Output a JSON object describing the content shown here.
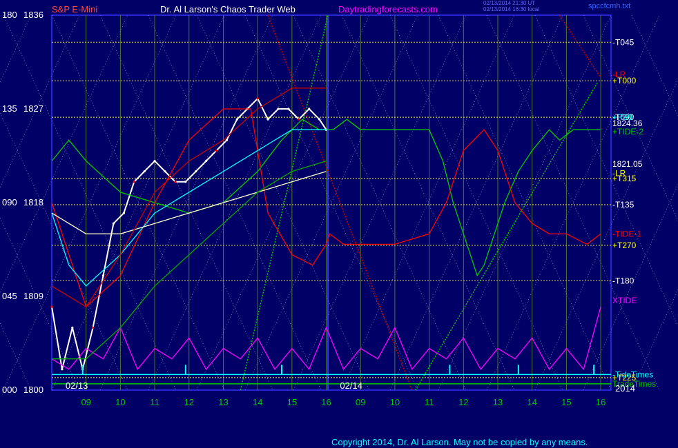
{
  "header": {
    "ticker": "S&P E-Mini",
    "title": "Dr. Al Larson's Chaos Trader Web",
    "website": "Daytradingforecasts.com",
    "timestamp1": "02/13/2014 21:30 UT",
    "timestamp2": "02/13/2014 16:30 local",
    "file": "spccfcmh.txt",
    "copyright": "Copyright 2014, Dr. Al Larson. May not be copied by any means."
  },
  "colors": {
    "background": "#000066",
    "plot_border": "#3333ff",
    "grid": "#4a7a2a",
    "yellow": "#ffff00",
    "red": "#ff0000",
    "green": "#00cc00",
    "cyan": "#00ffff",
    "magenta": "#ff00ff",
    "white": "#ffffff"
  },
  "chart_data": {
    "type": "line",
    "title": "S&P E-Mini",
    "y_ticks": [
      {
        "angle": "180",
        "price": "1836",
        "value": 1836
      },
      {
        "angle": "135",
        "price": "1827",
        "value": 1827
      },
      {
        "angle": "090",
        "price": "1818",
        "value": 1818
      },
      {
        "angle": "045",
        "price": "1809",
        "value": 1809
      },
      {
        "angle": "000",
        "price": "1800",
        "value": 1800
      }
    ],
    "ylim": [
      1800,
      1836
    ],
    "xlim": [
      8.0,
      24.3
    ],
    "date_labels": [
      {
        "label": "02/13",
        "x": 8.4
      },
      {
        "label": "02/14",
        "x": 16.4
      }
    ],
    "year_label": "2014",
    "x_ticks": [
      {
        "label": "09",
        "x": 9
      },
      {
        "label": "10",
        "x": 10
      },
      {
        "label": "11",
        "x": 11
      },
      {
        "label": "12",
        "x": 12
      },
      {
        "label": "13",
        "x": 13
      },
      {
        "label": "14",
        "x": 14
      },
      {
        "label": "15",
        "x": 15
      },
      {
        "label": "16",
        "x": 16
      },
      {
        "label": "09",
        "x": 17
      },
      {
        "label": "10",
        "x": 18
      },
      {
        "label": "11",
        "x": 19
      },
      {
        "label": "12",
        "x": 20
      },
      {
        "label": "13",
        "x": 21
      },
      {
        "label": "14",
        "x": 22
      },
      {
        "label": "15",
        "x": 23
      },
      {
        "label": "16",
        "x": 24
      }
    ],
    "day_divider_x": 16.05,
    "horizontal_levels": [
      {
        "label": "-T045",
        "value": 1833.4,
        "color": "#ffffff"
      },
      {
        "label": "+T000",
        "value": 1829.7,
        "color": "#ffff00"
      },
      {
        "label": "-T090",
        "value": 1826.2,
        "color": "#ffffff"
      },
      {
        "label": "+T315",
        "value": 1820.3,
        "color": "#ffff00"
      },
      {
        "label": "-T135",
        "value": 1817.8,
        "color": "#ffffff"
      },
      {
        "label": "+T270",
        "value": 1813.9,
        "color": "#ffff00"
      },
      {
        "label": "-T180",
        "value": 1810.5,
        "color": "#ffffff"
      },
      {
        "label": "+T225",
        "value": 1801.2,
        "color": "#ffff00"
      }
    ],
    "right_labels": [
      {
        "text": "-LR",
        "value": 1830.3,
        "color": "#ff0000"
      },
      {
        "text": "1824.36",
        "value": 1825.6,
        "color": "#ffffff"
      },
      {
        "text": "+R99",
        "value": 1826.2,
        "color": "#00ffff"
      },
      {
        "text": "+TIDE-2",
        "value": 1824.8,
        "color": "#00cc00"
      },
      {
        "text": "1821.05",
        "value": 1821.7,
        "color": "#ffffff"
      },
      {
        "text": "-LR",
        "value": 1820.8,
        "color": "#ffff00"
      },
      {
        "text": "-TIDE-1",
        "value": 1815.0,
        "color": "#ff0000"
      },
      {
        "text": "XTIDE",
        "value": 1808.6,
        "color": "#ff00ff"
      },
      {
        "text": "-TideTimes",
        "value": 1801.5,
        "color": "#00ffff"
      },
      {
        "text": "TradeTimes",
        "value": 1800.6,
        "color": "#00cc00"
      }
    ],
    "series": [
      {
        "name": "price",
        "color": "#ffffff",
        "x": [
          8.0,
          8.3,
          8.6,
          8.9,
          9.2,
          9.5,
          9.8,
          10.1,
          10.4,
          10.7,
          11.0,
          11.3,
          11.6,
          11.9,
          12.2,
          12.5,
          12.8,
          13.1,
          13.4,
          13.7,
          14.0,
          14.3,
          14.6,
          14.9,
          15.2,
          15.5,
          15.8,
          16.0
        ],
        "y": [
          1808,
          1802,
          1806,
          1802,
          1806,
          1811,
          1816,
          1817,
          1820,
          1821,
          1822,
          1821,
          1820,
          1820,
          1821,
          1822,
          1823,
          1824,
          1826,
          1827,
          1828,
          1826,
          1827,
          1827,
          1826,
          1827,
          1826,
          1825
        ]
      },
      {
        "name": "TIDE-2",
        "color": "#00cc00",
        "x": [
          8.0,
          8.5,
          9.0,
          10.0,
          11.0,
          12.0,
          13.0,
          14.0,
          14.7,
          15.3,
          15.8,
          16.2,
          16.6,
          17.0,
          18.0,
          19.0,
          19.4,
          19.7,
          20.0,
          20.4,
          20.6,
          20.8,
          21.2,
          21.6,
          22.0,
          22.5,
          22.8,
          23.2,
          23.6,
          24.0
        ],
        "y": [
          1822,
          1824,
          1822,
          1819,
          1818,
          1817,
          1818,
          1821,
          1824,
          1826,
          1825,
          1825,
          1826,
          1825,
          1825,
          1825,
          1822,
          1818,
          1815,
          1811,
          1812,
          1814,
          1818,
          1821,
          1823,
          1825,
          1824,
          1825,
          1825,
          1825
        ]
      },
      {
        "name": "TIDE-1",
        "color": "#ff0000",
        "x": [
          8.0,
          9.0,
          10.0,
          11.0,
          12.0,
          13.0,
          13.8,
          14.3,
          15.0,
          15.6,
          16.0,
          16.1,
          16.5,
          17.0,
          18.0,
          19.0,
          19.5,
          20.0,
          20.6,
          21.0,
          21.5,
          22.0,
          22.5,
          23.0,
          23.6,
          24.0
        ],
        "y": [
          1818,
          1808,
          1811,
          1818,
          1824,
          1827,
          1827,
          1817,
          1813,
          1812,
          1814,
          1815,
          1814,
          1814,
          1814,
          1815,
          1818,
          1823,
          1825,
          1823,
          1818,
          1816,
          1815,
          1815,
          1814,
          1815
        ]
      },
      {
        "name": "XTIDE",
        "color": "#ff00ff",
        "x": [
          8.0,
          8.5,
          9.0,
          9.5,
          10.0,
          10.5,
          11.0,
          11.5,
          12.0,
          12.5,
          13.0,
          13.5,
          14.0,
          14.5,
          15.0,
          15.5,
          16.0,
          16.5,
          17.0,
          17.5,
          18.0,
          18.5,
          19.0,
          19.5,
          20.0,
          20.5,
          21.0,
          21.5,
          22.0,
          22.5,
          23.0,
          23.5,
          24.0
        ],
        "y": [
          1803,
          1802,
          1804,
          1803,
          1806,
          1802,
          1804,
          1803,
          1805,
          1802,
          1804,
          1803,
          1805,
          1802,
          1804,
          1802,
          1806,
          1802,
          1804,
          1803,
          1806,
          1802,
          1804,
          1803,
          1805,
          1802,
          1804,
          1803,
          1805,
          1802,
          1804,
          1802,
          1808
        ]
      },
      {
        "name": "MA-cyan",
        "color": "#00ffff",
        "x": [
          8.0,
          8.5,
          9.0,
          10.0,
          11.0,
          12.0,
          13.0,
          14.0,
          15.0,
          16.0
        ],
        "y": [
          1817,
          1812,
          1810,
          1813,
          1817,
          1819,
          1821,
          1823,
          1825,
          1825
        ]
      },
      {
        "name": "MA-white",
        "color": "#ffffcc",
        "x": [
          8.0,
          9.0,
          10.0,
          11.0,
          12.0,
          13.0,
          14.0,
          15.0,
          16.0
        ],
        "y": [
          1817,
          1815,
          1815,
          1816,
          1817,
          1818,
          1819,
          1820,
          1821
        ]
      },
      {
        "name": "band-upper",
        "color": "#cc0000",
        "x": [
          8.0,
          9.0,
          10.0,
          11.0,
          12.0,
          13.0,
          14.0,
          15.0,
          16.0
        ],
        "y": [
          1810,
          1808,
          1813,
          1819,
          1822,
          1824,
          1827,
          1829,
          1829
        ]
      },
      {
        "name": "band-lower",
        "color": "#00aa00",
        "x": [
          8.0,
          9.0,
          10.0,
          11.0,
          12.0,
          13.0,
          14.0,
          15.0,
          16.0
        ],
        "y": [
          1803,
          1803,
          1806,
          1810,
          1813,
          1816,
          1819,
          1821,
          1822
        ]
      }
    ]
  }
}
